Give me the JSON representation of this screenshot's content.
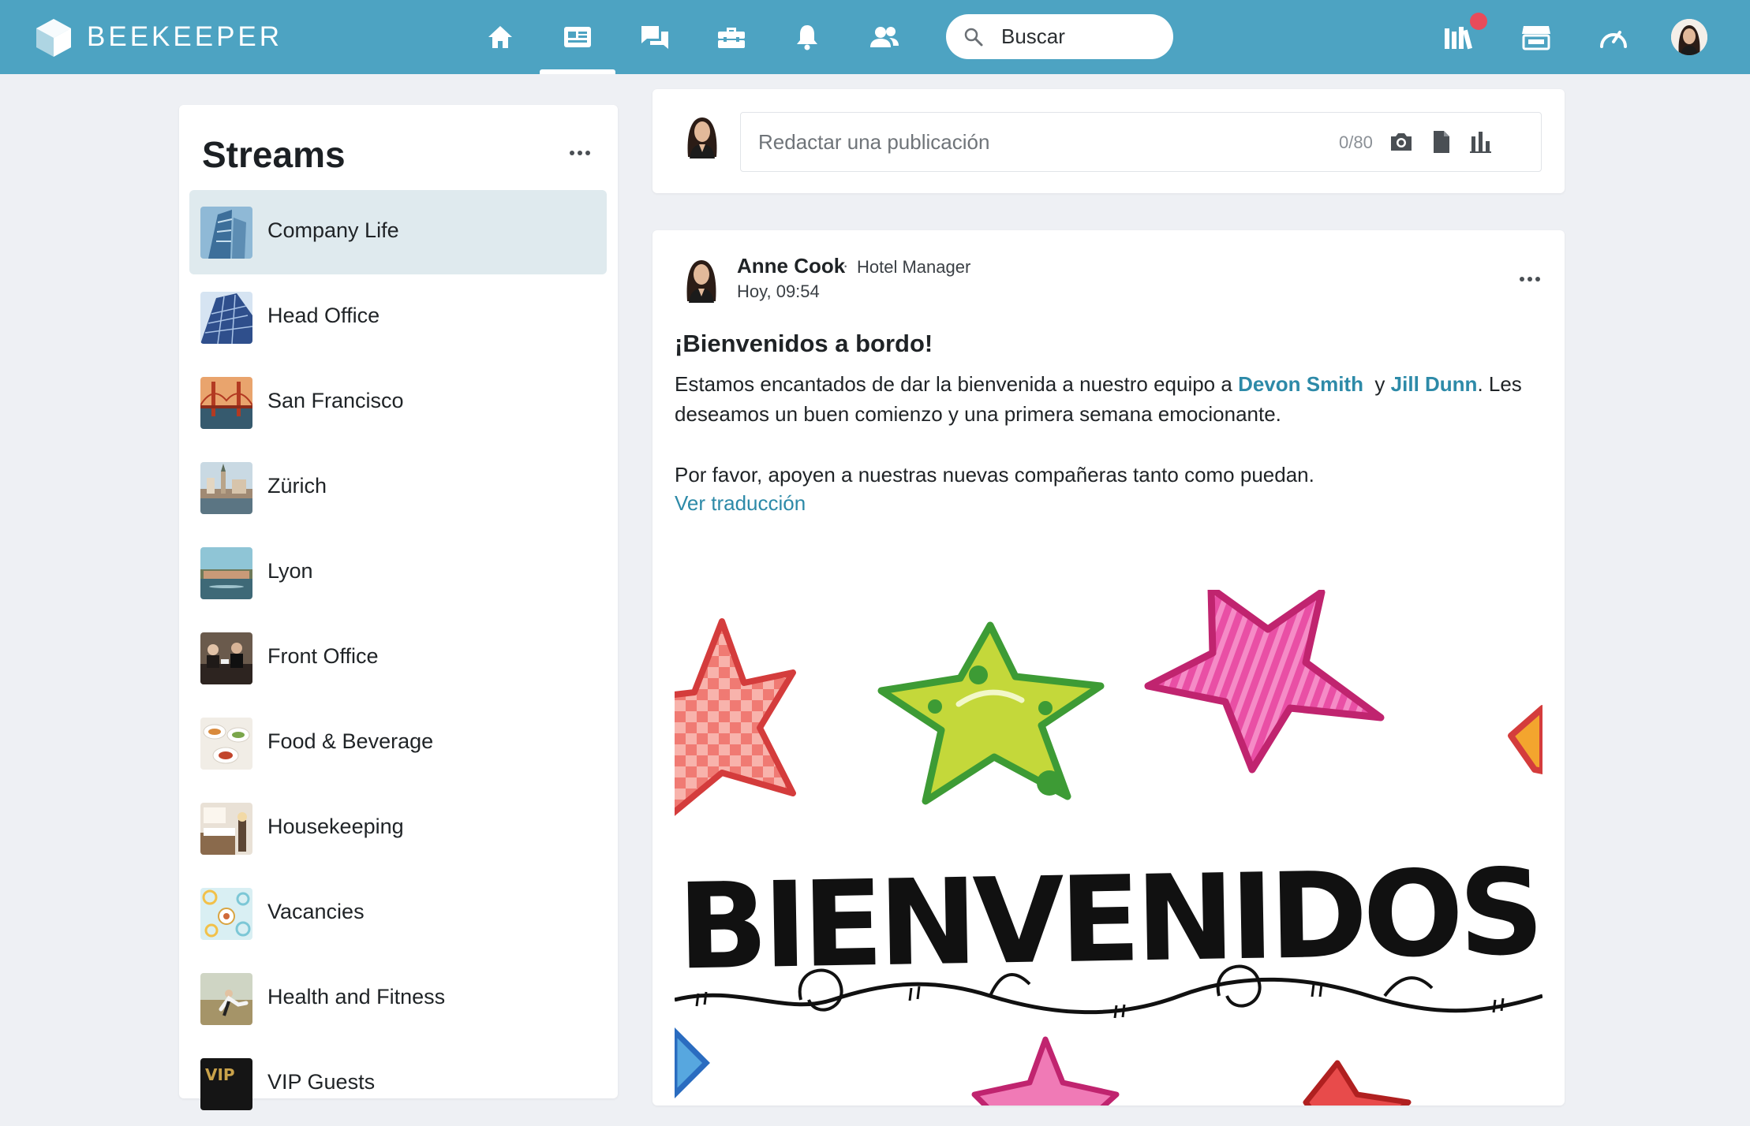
{
  "app": {
    "brand": "BEEKEEPER"
  },
  "nav": {
    "items": [
      {
        "name": "home",
        "icon": "home-icon"
      },
      {
        "name": "streams",
        "icon": "news-feed-icon",
        "active": true
      },
      {
        "name": "chats",
        "icon": "chat-icon"
      },
      {
        "name": "tools",
        "icon": "toolbox-icon"
      },
      {
        "name": "notifications",
        "icon": "bell-icon"
      },
      {
        "name": "people",
        "icon": "people-icon"
      }
    ],
    "right_items": [
      {
        "name": "library",
        "icon": "library-icon",
        "has_badge": true
      },
      {
        "name": "marketplace",
        "icon": "store-icon"
      },
      {
        "name": "dashboard",
        "icon": "speedometer-icon"
      }
    ]
  },
  "search": {
    "placeholder": "Buscar"
  },
  "sidebar": {
    "title": "Streams",
    "items": [
      {
        "label": "Company Life",
        "active": true
      },
      {
        "label": "Head Office"
      },
      {
        "label": "San Francisco"
      },
      {
        "label": "Zürich"
      },
      {
        "label": "Lyon"
      },
      {
        "label": "Front Office"
      },
      {
        "label": "Food & Beverage"
      },
      {
        "label": "Housekeeping"
      },
      {
        "label": "Vacancies"
      },
      {
        "label": "Health and Fitness"
      },
      {
        "label": "VIP Guests"
      }
    ]
  },
  "composer": {
    "placeholder": "Redactar una publicación",
    "counter": "0/80",
    "tools": [
      "camera-icon",
      "file-icon",
      "poll-icon"
    ]
  },
  "post": {
    "author": "Anne Cook",
    "separator": "·",
    "role": "Hotel Manager",
    "time": "Hoy, 09:54",
    "title": "¡Bienvenidos a bordo!",
    "body_before": "Estamos encantados de dar la bienvenida a nuestro equipo a ",
    "mention_1": "Devon Smith",
    "body_middle": "  y ",
    "mention_2": "Jill Dunn",
    "body_after": ". Les deseamos un buen comienzo y una primera semana emocionante.",
    "body_2": "Por favor, apoyen a nuestras nuevas compañeras tanto como puedan.",
    "translate_link": "Ver traducción",
    "image_text": "BIENVENIDOS"
  },
  "colors": {
    "topbar": "#4da3c2",
    "active_stream": "#dfeaee",
    "link": "#2d8aa8",
    "badge": "#e84b5a"
  }
}
